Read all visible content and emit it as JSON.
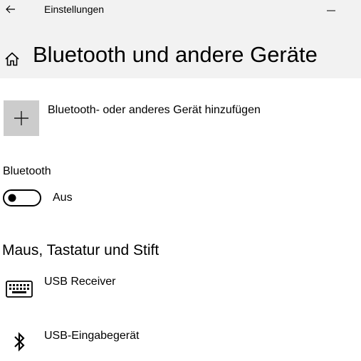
{
  "window": {
    "title": "Einstellungen"
  },
  "page": {
    "title": "Bluetooth und andere Geräte"
  },
  "add_device": {
    "label": "Bluetooth- oder anderes Gerät hinzufügen"
  },
  "bluetooth": {
    "heading": "Bluetooth",
    "state_label": "Aus",
    "enabled": false
  },
  "input_devices": {
    "heading": "Maus, Tastatur und Stift",
    "items": [
      {
        "name": "USB Receiver",
        "icon": "keyboard-icon"
      },
      {
        "name": "USB-Eingabegerät",
        "icon": "bluetooth-icon"
      }
    ]
  },
  "colors": {
    "header_bg": "#f2f2f2",
    "tile_bg": "#cccccc",
    "text": "#000000"
  }
}
